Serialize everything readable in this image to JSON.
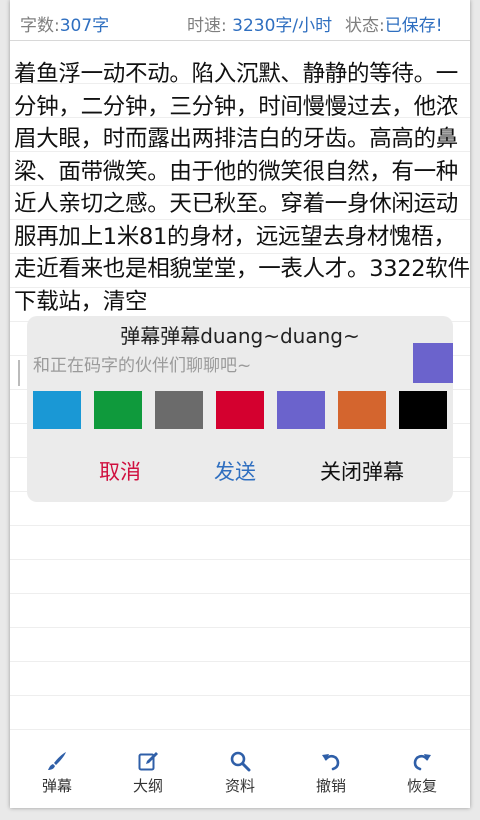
{
  "status": {
    "word_count_label": "字数:",
    "word_count_value": "307字",
    "speed_label": "时速: ",
    "speed_value": "3230字/小时",
    "save_label": "状态:",
    "save_value": "已保存!"
  },
  "editor": {
    "text": "着鱼浮一动不动。陷入沉默、静静的等待。一分钟，二分钟，三分钟，时间慢慢过去，他浓眉大眼，时而露出两排洁白的牙齿。高高的鼻梁、面带微笑。由于他的微笑很自然，有一种近人亲切之感。天已秋至。穿着一身休闲运动服再加上1米81的身材，远远望去身材愧梧，走近看来也是相貌堂堂，一表人才。3322软件下载站，清空"
  },
  "danmu": {
    "title": "弹幕弹幕duang~duang~",
    "placeholder": "和正在码字的伙伴们聊聊吧~",
    "selected_color": "#6b63cc",
    "colors": [
      "#1a98d5",
      "#0f9a3c",
      "#6b6b6b",
      "#d4002f",
      "#6b63cc",
      "#d4652e",
      "#000000"
    ],
    "cancel_label": "取消",
    "send_label": "发送",
    "close_label": "关闭弹幕"
  },
  "toolbar": {
    "icon_color": "#2f5fa8",
    "items": [
      {
        "label": "弹幕",
        "icon": "brush-icon"
      },
      {
        "label": "大纲",
        "icon": "edit-icon"
      },
      {
        "label": "资料",
        "icon": "search-icon"
      },
      {
        "label": "撤销",
        "icon": "undo-icon"
      },
      {
        "label": "恢复",
        "icon": "redo-icon"
      }
    ]
  }
}
